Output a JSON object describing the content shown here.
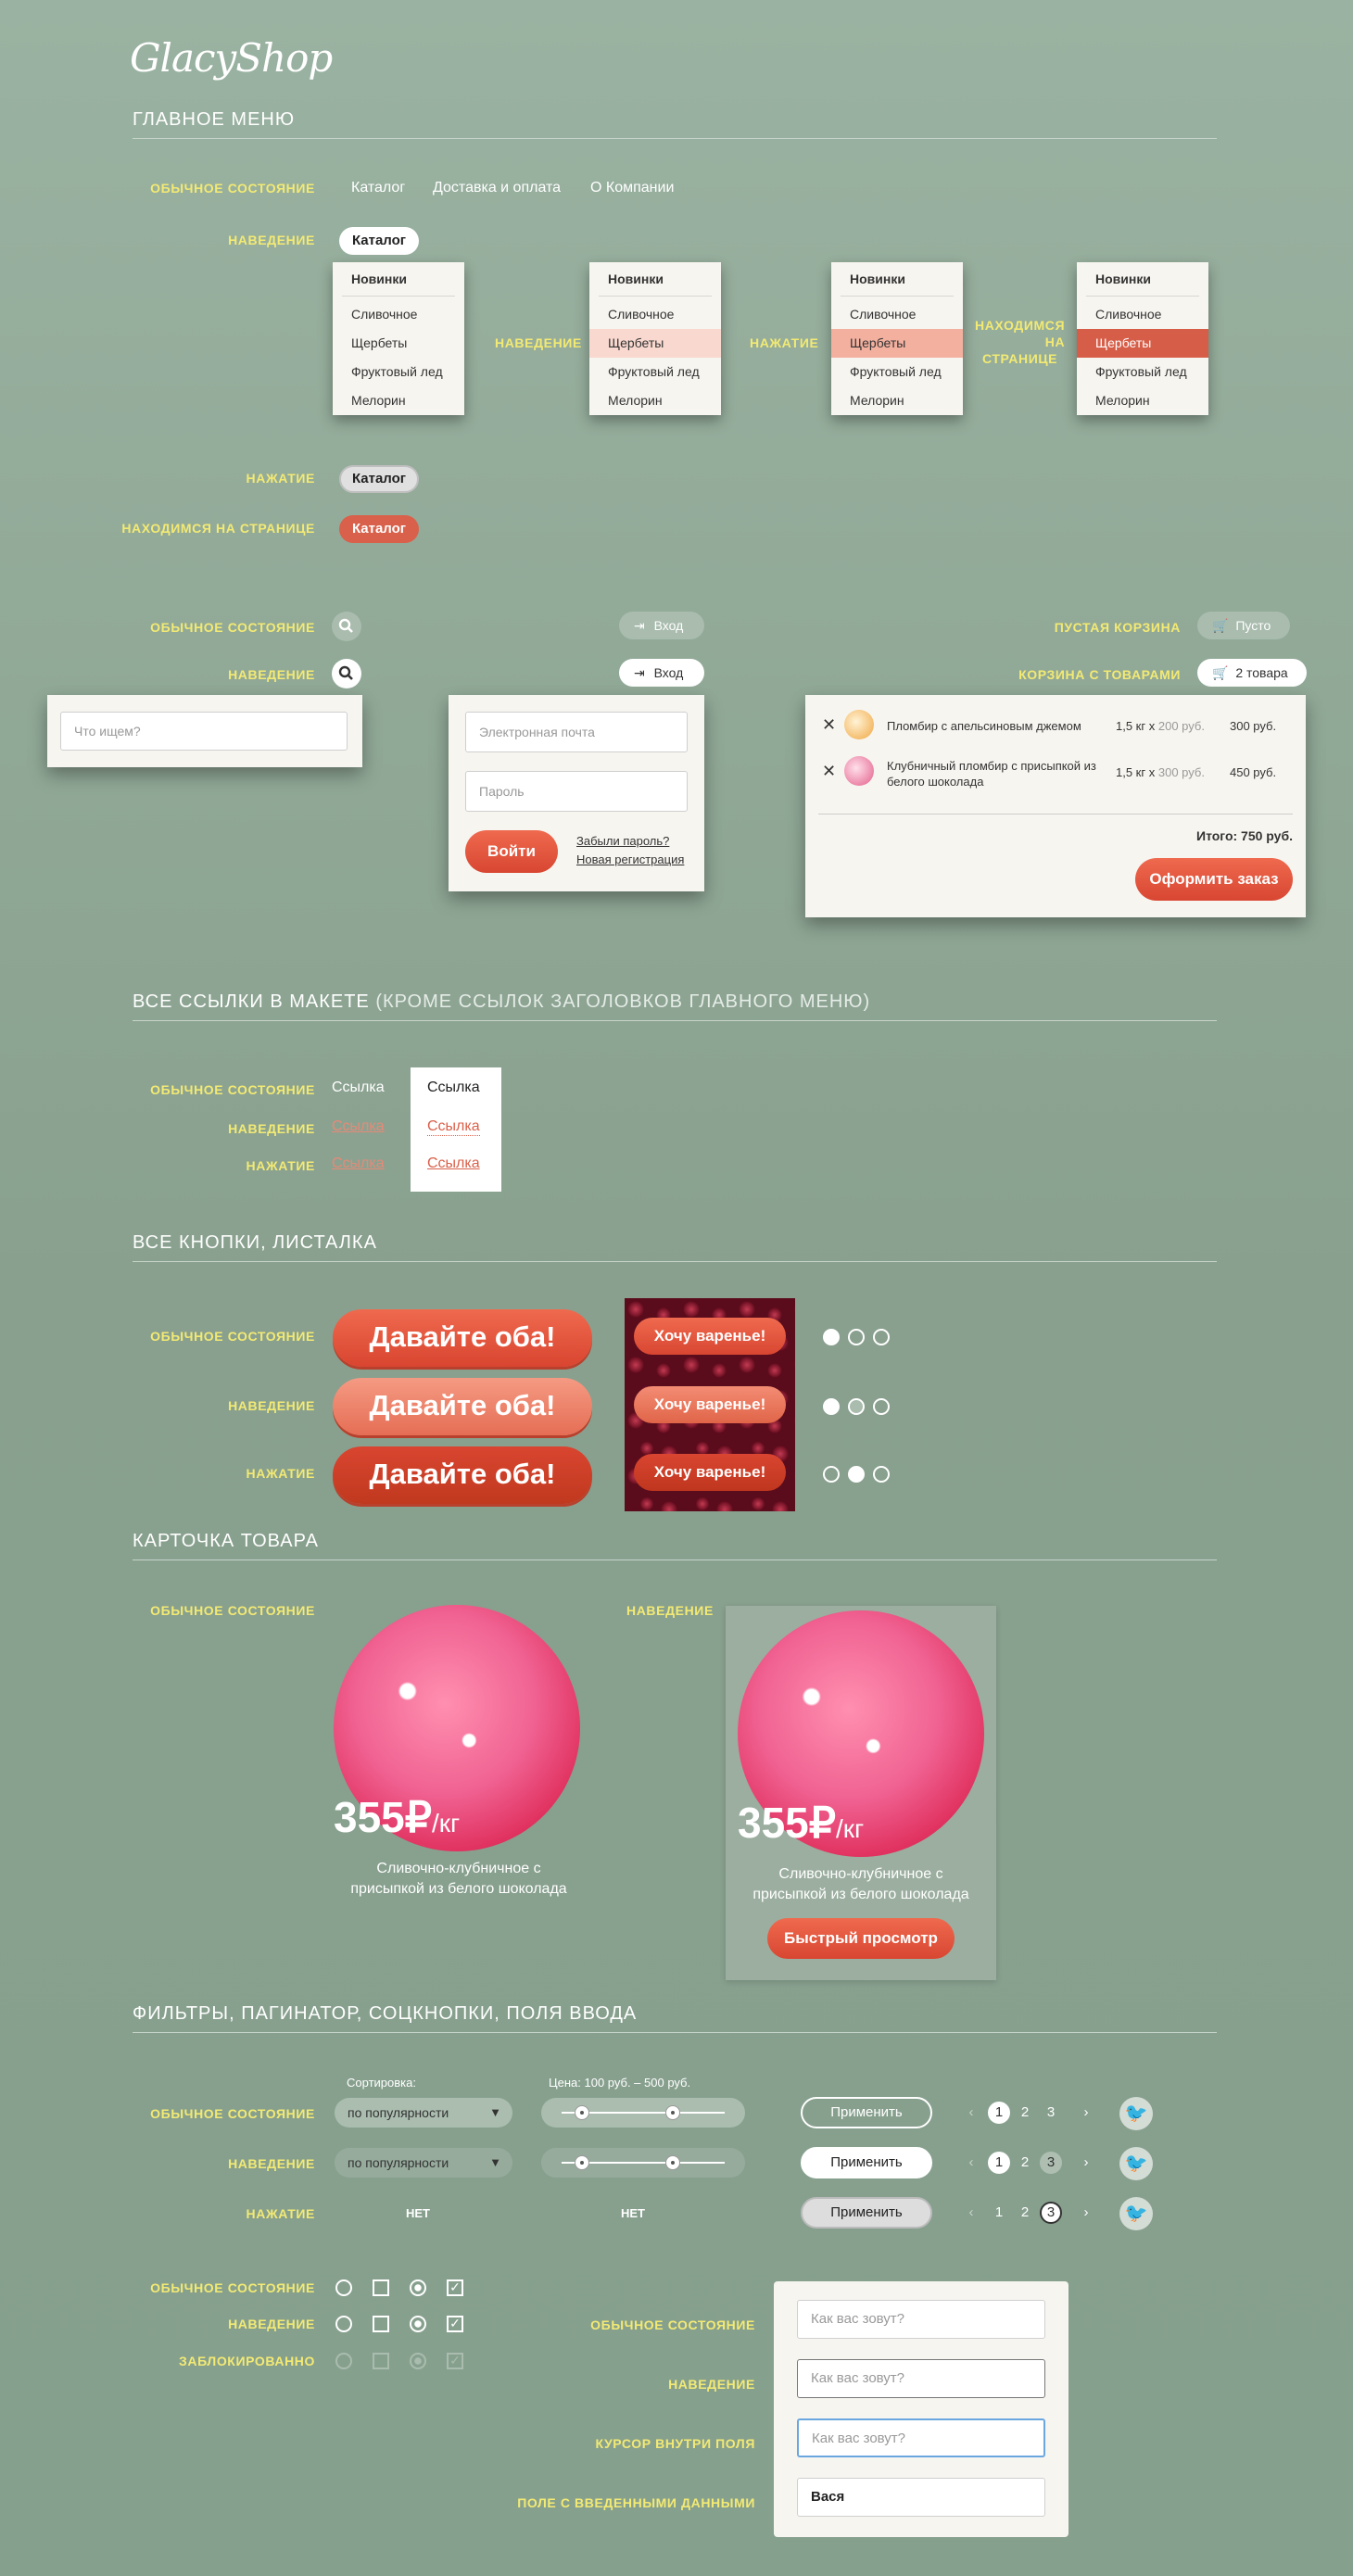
{
  "logo": "GlacyShop",
  "colors": {
    "accent": "#d9604a",
    "label": "#f3ea73",
    "background": "#8aa291"
  },
  "sections": {
    "main_menu": "ГЛАВНОЕ МЕНЮ",
    "links": "ВСЕ ССЫЛКИ В МАКЕТЕ",
    "links_note": "(КРОМЕ ССЫЛОК ЗАГОЛОВКОВ ГЛАВНОГО МЕНЮ)",
    "buttons": "ВСЕ КНОПКИ, ЛИСТАЛКА",
    "card": "КАРТОЧКА ТОВАРА",
    "filters": "ФИЛЬТРЫ, ПАГИНАТОР, СОЦКНОПКИ, ПОЛЯ ВВОДА"
  },
  "states": {
    "normal": "ОБЫЧНОЕ СОСТОЯНИЕ",
    "hover": "НАВЕДЕНИЕ",
    "press": "НАЖАТИЕ",
    "on_page": "НАХОДИМСЯ НА СТРАНИЦЕ",
    "on_page_l1": "НАХОДИМСЯ",
    "on_page_l2": "НА",
    "on_page_l3": "СТРАНИЦЕ",
    "empty_cart": "ПУСТАЯ КОРЗИНА",
    "cart_items": "КОРЗИНА С ТОВАРАМИ",
    "disabled": "ЗАБЛОКИРОВАННО",
    "cursor_in": "КУРСОР ВНУТРИ ПОЛЯ",
    "filled": "ПОЛЕ С ВВЕДЕННЫМИ ДАННЫМИ",
    "none": "НЕТ"
  },
  "menu": {
    "catalog": "Каталог",
    "delivery": "Доставка и оплата",
    "about": "О Компании",
    "items": [
      "Новинки",
      "Сливочное",
      "Щербеты",
      "Фруктовый лед",
      "Мелорин"
    ]
  },
  "search": {
    "placeholder": "Что ищем?"
  },
  "login": {
    "button": "Вход",
    "email": "Электронная почта",
    "password": "Пароль",
    "submit": "Войти",
    "forgot": "Забыли пароль?",
    "register": "Новая регистрация"
  },
  "cart": {
    "empty": "Пусто",
    "count": "2 товара",
    "items": [
      {
        "name": "Пломбир с апельсиновым джемом",
        "qty": "1,5 кг х",
        "unit": "200 руб.",
        "total": "300 руб."
      },
      {
        "name": "Клубничный пломбир с присыпкой из белого шоколада",
        "qty": "1,5 кг х",
        "unit": "300 руб.",
        "total": "450 руб."
      }
    ],
    "sum": "Итого: 750 руб.",
    "order": "Оформить заказ"
  },
  "link_text": "Ссылка",
  "big_button": "Давайте оба!",
  "jam_button": "Хочу варенье!",
  "card": {
    "price": "355₽",
    "unit": "/кг",
    "name_l1": "Сливочно-клубничное с",
    "name_l2": "присыпкой из белого шоколада",
    "quick": "Быстрый просмотр"
  },
  "filters": {
    "sort_label": "Сортировка:",
    "sort_value": "по популярности",
    "price_label": "Цена: 100 руб. – 500 руб.",
    "apply": "Применить",
    "pages": [
      "1",
      "2",
      "3"
    ],
    "prev": "‹",
    "next": "›"
  },
  "form": {
    "placeholder": "Как вас зовут?",
    "value": "Вася"
  }
}
